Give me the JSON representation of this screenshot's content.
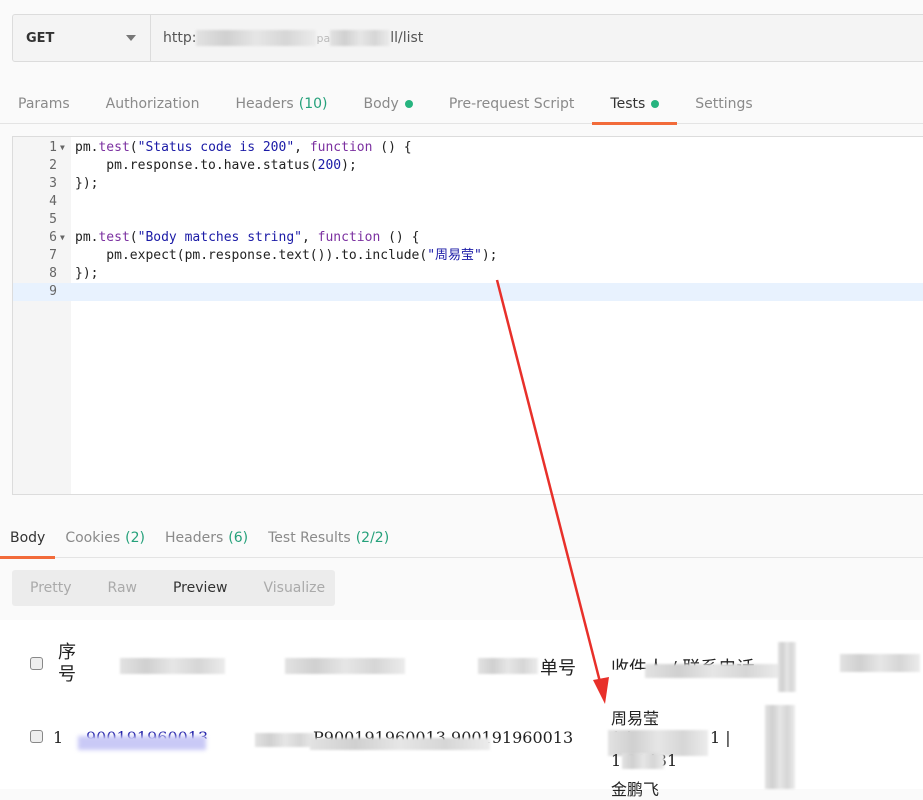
{
  "request": {
    "method": "GET",
    "url_prefix": "http:",
    "url_mid": "pa",
    "url_suffix": "ll/list"
  },
  "tabs": [
    {
      "label": "Params"
    },
    {
      "label": "Authorization"
    },
    {
      "label": "Headers",
      "count": "(10)"
    },
    {
      "label": "Body",
      "dot": true
    },
    {
      "label": "Pre-request Script"
    },
    {
      "label": "Tests",
      "dot": true,
      "active": true
    },
    {
      "label": "Settings"
    }
  ],
  "editor": {
    "lines": [
      [
        [
          "pm.",
          ""
        ],
        [
          "test",
          "k"
        ],
        [
          "(",
          ""
        ],
        [
          "\"Status code is 200\"",
          "s"
        ],
        [
          ", ",
          ""
        ],
        [
          "function",
          "k"
        ],
        [
          " () {",
          ""
        ]
      ],
      [
        [
          "    pm.response.to.have.status(",
          ""
        ],
        [
          "200",
          "n"
        ],
        [
          ");",
          ""
        ]
      ],
      [
        [
          "});",
          ""
        ]
      ],
      [],
      [],
      [
        [
          "pm.",
          ""
        ],
        [
          "test",
          "k"
        ],
        [
          "(",
          ""
        ],
        [
          "\"Body matches string\"",
          "s"
        ],
        [
          ", ",
          ""
        ],
        [
          "function",
          "k"
        ],
        [
          " () {",
          ""
        ]
      ],
      [
        [
          "    pm.expect(pm.response.text()).to.include(",
          ""
        ],
        [
          "\"周易莹\"",
          "s"
        ],
        [
          ");",
          ""
        ]
      ],
      [
        [
          "});",
          ""
        ]
      ],
      []
    ]
  },
  "response_tabs": [
    {
      "label": "Body",
      "active": true
    },
    {
      "label": "Cookies",
      "count": "(2)"
    },
    {
      "label": "Headers",
      "count": "(6)"
    },
    {
      "label": "Test Results",
      "count": "(2/2)"
    }
  ],
  "modes": [
    {
      "label": "Pretty"
    },
    {
      "label": "Raw"
    },
    {
      "label": "Preview",
      "active": true
    },
    {
      "label": "Visualize"
    }
  ],
  "preview": {
    "header_seq": "序号",
    "header_order": "单号",
    "header_recipient": "收件人 / 联系电话",
    "row_index": "1",
    "row_link": "900191960013",
    "row_code": "P900191960013 900191960013",
    "row_name": "周易莹",
    "row_phone1": "1 |",
    "row_phone2": "1 30431",
    "row_more": "金鹏飞"
  },
  "annotation": {
    "arrow_color": "#e8302a"
  }
}
